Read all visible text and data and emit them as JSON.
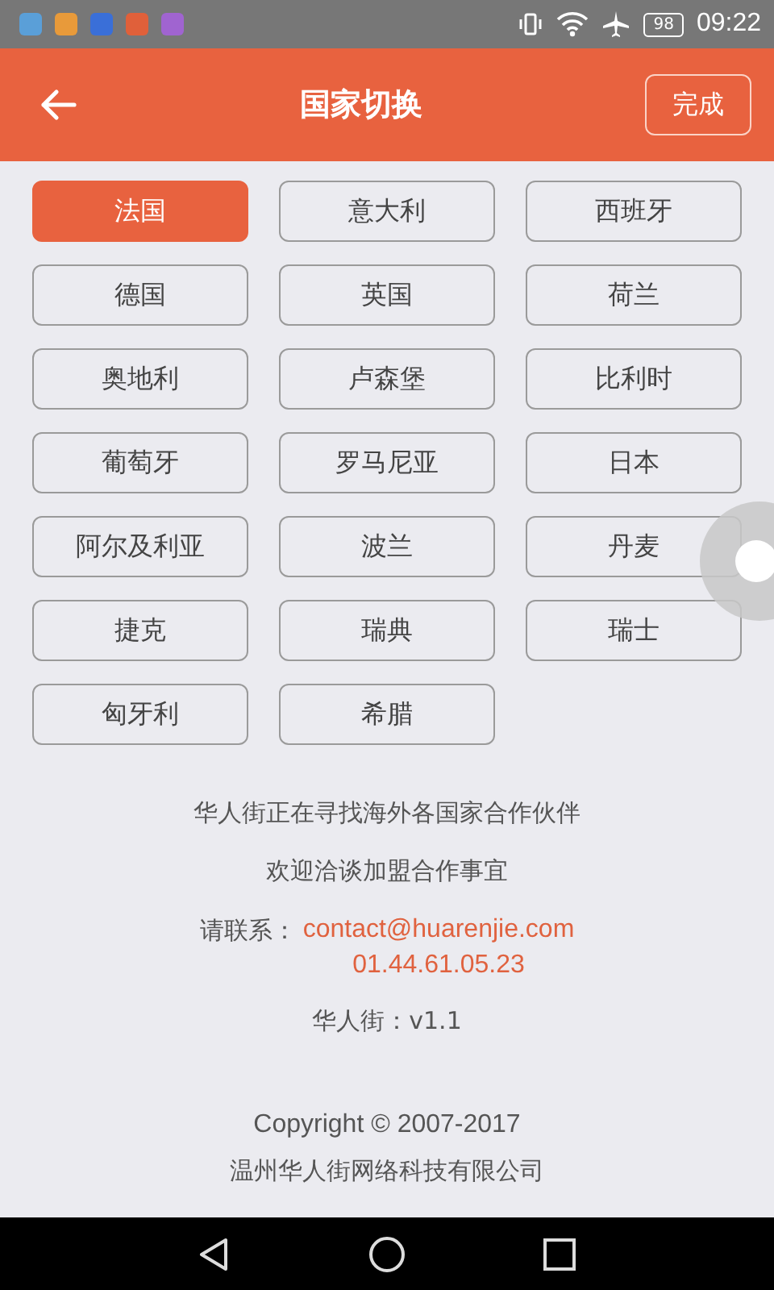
{
  "status_bar": {
    "battery": "98",
    "time": "09:22"
  },
  "header": {
    "title": "国家切换",
    "done_button": "完成"
  },
  "countries": [
    {
      "label": "法国",
      "selected": true
    },
    {
      "label": "意大利",
      "selected": false
    },
    {
      "label": "西班牙",
      "selected": false
    },
    {
      "label": "德国",
      "selected": false
    },
    {
      "label": "英国",
      "selected": false
    },
    {
      "label": "荷兰",
      "selected": false
    },
    {
      "label": "奥地利",
      "selected": false
    },
    {
      "label": "卢森堡",
      "selected": false
    },
    {
      "label": "比利时",
      "selected": false
    },
    {
      "label": "葡萄牙",
      "selected": false
    },
    {
      "label": "罗马尼亚",
      "selected": false
    },
    {
      "label": "日本",
      "selected": false
    },
    {
      "label": "阿尔及利亚",
      "selected": false
    },
    {
      "label": "波兰",
      "selected": false
    },
    {
      "label": "丹麦",
      "selected": false
    },
    {
      "label": "捷克",
      "selected": false
    },
    {
      "label": "瑞典",
      "selected": false
    },
    {
      "label": "瑞士",
      "selected": false
    },
    {
      "label": "匈牙利",
      "selected": false
    },
    {
      "label": "希腊",
      "selected": false
    }
  ],
  "info": {
    "lines": [
      "华人街正在寻找海外各国家合作伙伴",
      "欢迎洽谈加盟合作事宜"
    ],
    "contact_label": "请联系：",
    "email": "contact@huarenjie.com",
    "phone": "01.44.61.05.23",
    "version": "华人街：v1.1"
  },
  "footer": {
    "copyright": "Copyright © 2007-2017",
    "company": "温州华人街网络科技有限公司"
  }
}
